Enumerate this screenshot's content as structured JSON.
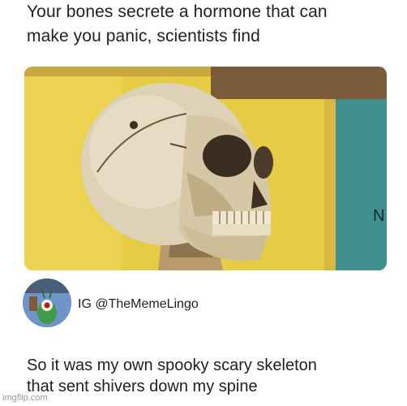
{
  "headline": {
    "line1": "Your bones secrete a hormone that can",
    "line2": "make you panic, scientists find"
  },
  "photo": {
    "subject": "human skull on yellow background",
    "corner_letter": "N"
  },
  "author": {
    "handle": "IG @TheMemeLingo",
    "avatar": "plankton-character-icon"
  },
  "caption": {
    "line1": "So it was my own spooky scary skeleton",
    "line2": "that sent shivers down my spine"
  },
  "watermark": "imgflip.com",
  "colors": {
    "background": "#ffffff",
    "photo_yellow": "#e9d14e",
    "photo_teal": "#3f8f8e",
    "skull": "#ddd2b6"
  }
}
